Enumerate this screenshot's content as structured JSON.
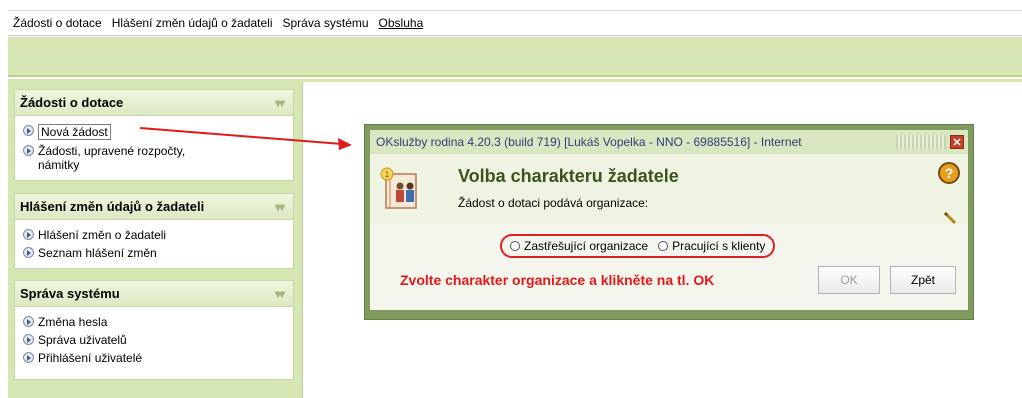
{
  "menu": {
    "items": [
      {
        "label": "Žádosti o dotace",
        "underline": false
      },
      {
        "label": "Hlášení změn údajů o žadateli",
        "underline": false
      },
      {
        "label": "Správa systému",
        "underline": false
      },
      {
        "label": "Obsluha",
        "underline": true
      }
    ]
  },
  "sidebar": {
    "panels": [
      {
        "title": "Žádosti o dotace",
        "items": [
          "Nová žádost",
          "Žádosti, upravené rozpočty, námitky"
        ]
      },
      {
        "title": "Hlášení změn údajů o žadateli",
        "items": [
          "Hlášení změn o žadateli",
          "Seznam hlášení změn"
        ]
      },
      {
        "title": "Správa systému",
        "items": [
          "Změna hesla",
          "Správa uživatelů",
          "Přihlášení uživatelé"
        ]
      }
    ]
  },
  "dialog": {
    "title": "OKslužby rodina 4.20.3 (build 719)  [Lukáš Vopelka - NNO - 69885516] - Internet",
    "heading": "Volba charakteru žadatele",
    "subtitle": "Žádost o dotaci podává organizace:",
    "radio_options": [
      "Zastřešující organizace",
      "Pracující s klienty"
    ],
    "instruction": "Zvolte charakter organizace a klikněte na tl. OK",
    "ok_label": "OK",
    "back_label": "Zpět",
    "help_glyph": "?",
    "close_glyph": "✕"
  },
  "colors": {
    "accent_green": "#d6e7b4",
    "dialog_frame": "#7f9a5f",
    "annotation_red": "#e01a1a"
  }
}
